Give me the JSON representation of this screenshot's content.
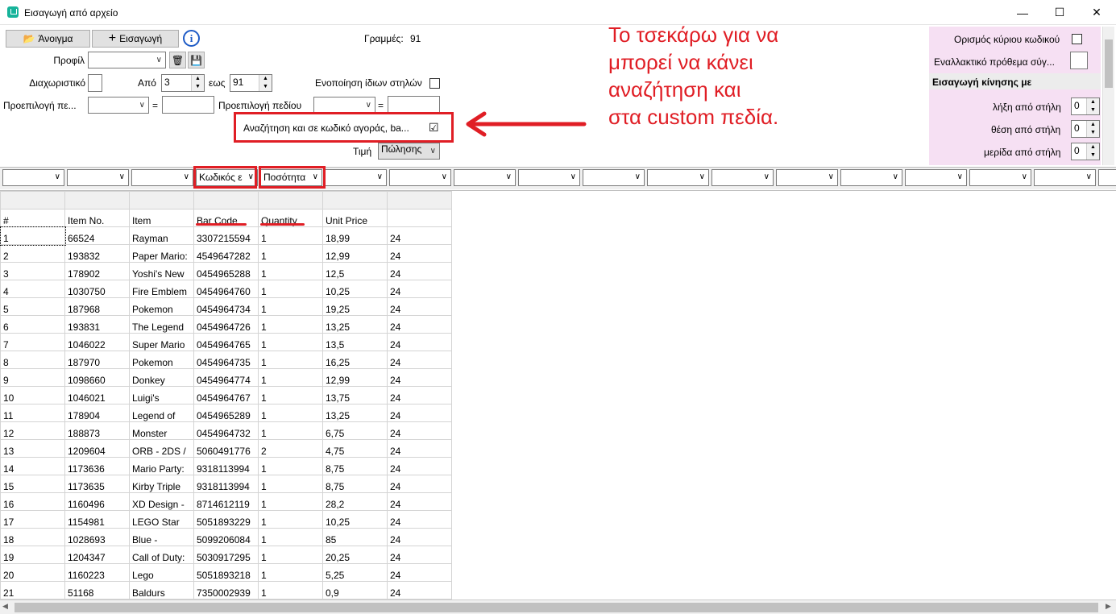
{
  "window": {
    "title": "Εισαγωγή από αρχείο",
    "minimize": "—",
    "maximize": "☐",
    "close": "✕"
  },
  "toolbar": {
    "open_label": "Άνοιγμα",
    "import_label": "Εισαγωγή",
    "rows_label": "Γραμμές:",
    "rows_value": "91"
  },
  "form": {
    "profile_label": "Προφίλ",
    "profile_value": "",
    "separator_label": "Διαχωριστικό",
    "separator_value": "",
    "from_label": "Από",
    "from_value": "3",
    "to_label": "εως",
    "to_value": "91",
    "merge_label": "Ενοποίηση ίδιων στηλών",
    "preselect_label1": "Προεπιλογή πε...",
    "preselect_value1": "",
    "eq1": "=",
    "preselect_label2": "Προεπιλογή πεδίου",
    "preselect_value2": "",
    "eq2": "=",
    "search_custom_label": "Αναζήτηση και σε κωδικό αγοράς, ba...",
    "search_custom_checked": "☑",
    "price_label": "Τιμή",
    "price_value": "Πώλησης"
  },
  "right_panel": {
    "main_code_label": "Ορισμός κύριου κωδικού",
    "alt_prefix_label": "Εναλλακτικό πρόθεμα σύγ...",
    "section_title": "Εισαγωγή κίνησης με",
    "end_col_label": "λήξη από στήλη",
    "end_col_value": "0",
    "pos_col_label": "θέση από στήλη",
    "pos_col_value": "0",
    "part_col_label": "μερίδα από στήλη",
    "part_col_value": "0"
  },
  "column_combos": [
    "",
    "",
    "",
    "Κωδικός ε",
    "Ποσότητα",
    "",
    "",
    "",
    "",
    "",
    "",
    "",
    "",
    "",
    "",
    "",
    "",
    ""
  ],
  "table": {
    "headers": [
      "#",
      "Item No.",
      "Item",
      "Bar Code",
      "Quantity",
      "Unit Price",
      ""
    ],
    "rows": [
      [
        "1",
        "66524",
        "Rayman",
        "3307215594",
        "1",
        "18,99",
        "24"
      ],
      [
        "2",
        "193832",
        "Paper Mario:",
        "4549647282",
        "1",
        "12,99",
        "24"
      ],
      [
        "3",
        "178902",
        "Yoshi's New",
        "0454965288",
        "1",
        "12,5",
        "24"
      ],
      [
        "4",
        "1030750",
        "Fire Emblem",
        "0454964760",
        "1",
        "10,25",
        "24"
      ],
      [
        "5",
        "187968",
        "Pokemon",
        "0454964734",
        "1",
        "19,25",
        "24"
      ],
      [
        "6",
        "193831",
        "The Legend",
        "0454964726",
        "1",
        "13,25",
        "24"
      ],
      [
        "7",
        "1046022",
        "Super Mario",
        "0454964765",
        "1",
        "13,5",
        "24"
      ],
      [
        "8",
        "187970",
        "Pokemon",
        "0454964735",
        "1",
        "16,25",
        "24"
      ],
      [
        "9",
        "1098660",
        "Donkey",
        "0454964774",
        "1",
        "12,99",
        "24"
      ],
      [
        "10",
        "1046021",
        "Luigi's",
        "0454964767",
        "1",
        "13,75",
        "24"
      ],
      [
        "11",
        "178904",
        "Legend of",
        "0454965289",
        "1",
        "13,25",
        "24"
      ],
      [
        "12",
        "188873",
        "Monster",
        "0454964732",
        "1",
        "6,75",
        "24"
      ],
      [
        "13",
        "1209604",
        "ORB - 2DS /",
        "5060491776",
        "2",
        "4,75",
        "24"
      ],
      [
        "14",
        "1173636",
        "Mario Party:",
        "9318113994",
        "1",
        "8,75",
        "24"
      ],
      [
        "15",
        "1173635",
        "Kirby Triple",
        "9318113994",
        "1",
        "8,75",
        "24"
      ],
      [
        "16",
        "1160496",
        "XD Design -",
        "8714612119",
        "1",
        "28,2",
        "24"
      ],
      [
        "17",
        "1154981",
        "LEGO Star",
        "5051893229",
        "1",
        "10,25",
        "24"
      ],
      [
        "18",
        "1028693",
        "Blue -",
        "5099206084",
        "1",
        "85",
        "24"
      ],
      [
        "19",
        "1204347",
        "Call of Duty:",
        "5030917295",
        "1",
        "20,25",
        "24"
      ],
      [
        "20",
        "1160223",
        "Lego",
        "5051893218",
        "1",
        "5,25",
        "24"
      ],
      [
        "21",
        "51168",
        "Baldurs",
        "7350002939",
        "1",
        "0,9",
        "24"
      ]
    ]
  },
  "annotation": {
    "line1": "Το τσεκάρω για να",
    "line2": "μπορεί να κάνει",
    "line3": "αναζήτηση και",
    "line4": "στα custom πεδία."
  },
  "colors": {
    "accent_red": "#e01e25",
    "panel_pink": "#f6e0f3",
    "info_blue": "#1e5bc6"
  }
}
